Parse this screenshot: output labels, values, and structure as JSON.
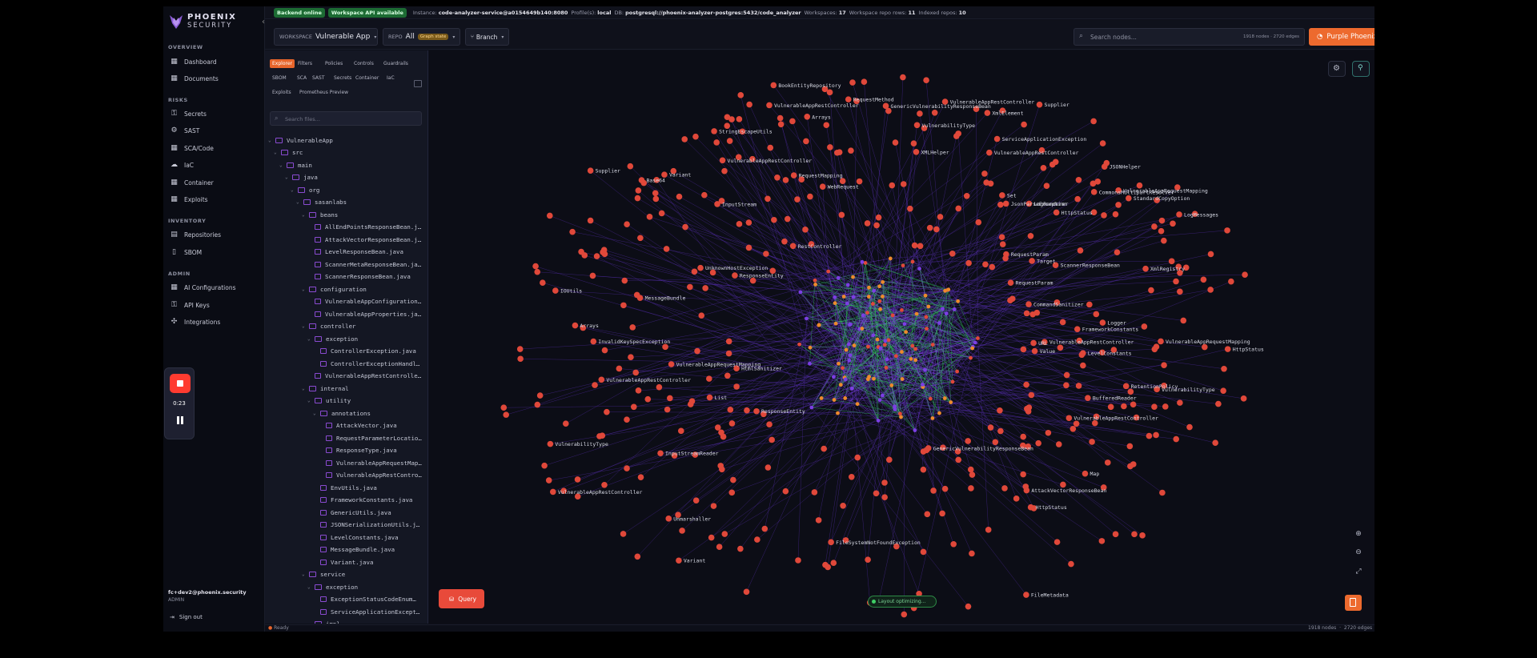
{
  "brand": {
    "name": "PHOENIX",
    "sub": "SECURITY"
  },
  "sidebar": {
    "sections": {
      "overview": "OVERVIEW",
      "risks": "RISKS",
      "inventory": "INVENTORY",
      "admin": "ADMIN"
    },
    "items": [
      {
        "label": "Dashboard",
        "icon": "grid-icon"
      },
      {
        "label": "Documents",
        "icon": "grid-icon"
      },
      {
        "label": "Secrets",
        "icon": "key-icon"
      },
      {
        "label": "SAST",
        "icon": "gear-icon"
      },
      {
        "label": "SCA/Code",
        "icon": "grid-icon"
      },
      {
        "label": "IaC",
        "icon": "cloud-icon"
      },
      {
        "label": "Container",
        "icon": "grid-icon"
      },
      {
        "label": "Exploits",
        "icon": "grid-icon"
      },
      {
        "label": "Repositories",
        "icon": "repo-icon"
      },
      {
        "label": "SBOM",
        "icon": "doc-icon"
      },
      {
        "label": "AI Configurations",
        "icon": "grid-icon"
      },
      {
        "label": "API Keys",
        "icon": "key-icon"
      },
      {
        "label": "Integrations",
        "icon": "puzzle-icon"
      }
    ],
    "user": "fc+dev2@phoenix.security",
    "role": "ADMIN",
    "signout": "Sign out",
    "recorder_time": "0:23"
  },
  "statusbar": {
    "backend": "Backend online",
    "workspace_api": "Workspace API available",
    "instance_label": "Instance:",
    "instance": "code-analyzer-service@a0154649b140:8080",
    "profile_label": "Profile(s):",
    "profile": "local",
    "db_label": "DB:",
    "db": "postgresql://phoenix-analyzer-postgres:5432/code_analyzer",
    "workspaces_label": "Workspaces:",
    "workspaces": "17",
    "repo_rows_label": "Workspace repo rows:",
    "repo_rows": "11",
    "indexed_label": "Indexed repos:",
    "indexed": "10"
  },
  "toolbar": {
    "workspace_label": "WORKSPACE",
    "workspace_value": "Vulnerable App",
    "repo_label": "REPO",
    "repo_value": "All",
    "graph_state": "Graph state",
    "branch": "Branch",
    "search_placeholder": "Search nodes...",
    "counts": "1918 nodes · 2720 edges",
    "triager": "Purple Phoenix Agentic Code Triager",
    "accent": "#ed6a2e"
  },
  "explorer": {
    "tabs_row1": [
      "Explorer",
      "Filters",
      "Policies",
      "Controls",
      "Guardrails"
    ],
    "tabs_row2": [
      "SBOM",
      "SCA",
      "SAST",
      "Secrets",
      "Container",
      "IaC"
    ],
    "tabs_row3": [
      "Exploits",
      "Prometheus Preview"
    ],
    "search_placeholder": "Search files...",
    "tree": [
      {
        "d": 0,
        "t": "dir",
        "name": "VulnerableApp"
      },
      {
        "d": 1,
        "t": "dir",
        "name": "src"
      },
      {
        "d": 2,
        "t": "dir",
        "name": "main"
      },
      {
        "d": 3,
        "t": "dir",
        "name": "java"
      },
      {
        "d": 4,
        "t": "dir",
        "name": "org"
      },
      {
        "d": 5,
        "t": "dir",
        "name": "sasanlabs"
      },
      {
        "d": 6,
        "t": "dir",
        "name": "beans"
      },
      {
        "d": 7,
        "t": "file",
        "name": "AllEndPointsResponseBean.j…"
      },
      {
        "d": 7,
        "t": "file",
        "name": "AttackVectorResponseBean.j…"
      },
      {
        "d": 7,
        "t": "file",
        "name": "LevelResponseBean.java"
      },
      {
        "d": 7,
        "t": "file",
        "name": "ScannerMetaResponseBean.ja…"
      },
      {
        "d": 7,
        "t": "file",
        "name": "ScannerResponseBean.java"
      },
      {
        "d": 6,
        "t": "dir",
        "name": "configuration"
      },
      {
        "d": 7,
        "t": "file",
        "name": "VulnerableAppConfiguration…"
      },
      {
        "d": 7,
        "t": "file",
        "name": "VulnerableAppProperties.ja…"
      },
      {
        "d": 6,
        "t": "dir",
        "name": "controller"
      },
      {
        "d": 7,
        "t": "dir",
        "name": "exception"
      },
      {
        "d": 8,
        "t": "file",
        "name": "ControllerException.java"
      },
      {
        "d": 8,
        "t": "file",
        "name": "ControllerExceptionHandl…"
      },
      {
        "d": 7,
        "t": "file",
        "name": "VulnerableAppRestControlle…"
      },
      {
        "d": 6,
        "t": "dir",
        "name": "internal"
      },
      {
        "d": 7,
        "t": "dir",
        "name": "utility"
      },
      {
        "d": 8,
        "t": "dir",
        "name": "annotations"
      },
      {
        "d": 9,
        "t": "file",
        "name": "AttackVector.java"
      },
      {
        "d": 9,
        "t": "file",
        "name": "RequestParameterLocatio…"
      },
      {
        "d": 9,
        "t": "file",
        "name": "ResponseType.java"
      },
      {
        "d": 9,
        "t": "file",
        "name": "VulnerableAppRequestMap…"
      },
      {
        "d": 9,
        "t": "file",
        "name": "VulnerableAppRestContro…"
      },
      {
        "d": 8,
        "t": "file",
        "name": "EnvUtils.java"
      },
      {
        "d": 8,
        "t": "file",
        "name": "FrameworkConstants.java"
      },
      {
        "d": 8,
        "t": "file",
        "name": "GenericUtils.java"
      },
      {
        "d": 8,
        "t": "file",
        "name": "JSONSerializationUtils.j…"
      },
      {
        "d": 8,
        "t": "file",
        "name": "LevelConstants.java"
      },
      {
        "d": 8,
        "t": "file",
        "name": "MessageBundle.java"
      },
      {
        "d": 8,
        "t": "file",
        "name": "Variant.java"
      },
      {
        "d": 6,
        "t": "dir",
        "name": "service"
      },
      {
        "d": 7,
        "t": "dir",
        "name": "exception"
      },
      {
        "d": 8,
        "t": "file",
        "name": "ExceptionStatusCodeEnum…"
      },
      {
        "d": 8,
        "t": "file",
        "name": "ServiceApplicationExcept…"
      },
      {
        "d": 7,
        "t": "dir",
        "name": "impl"
      }
    ]
  },
  "graph": {
    "labels": [
      "VulnerableAppRestController",
      "VulnerabilityType",
      "VulnerableAppRestController",
      "Variant",
      "Variant",
      "UnknownHostException",
      "ResponseEntity",
      "VulnerableAppRestController",
      "ResponseEntity",
      "RequestParam",
      "JSONHelper",
      "VulnerableAppRestController",
      "VulnerableAppRequestMapping",
      "Supplier",
      "MessageBundle",
      "HttpStatus",
      "InputStream",
      "Optional",
      "WebRequest",
      "GenericVulnerabilityResponseBean",
      "IOUtils",
      "XmlRegistry",
      "CommonsMultipartResolver",
      "InputStreamReader",
      "GenericVulnerabilityResponseBean",
      "URL",
      "ServiceApplicationException",
      "BookEntityRepository",
      "Logger",
      "VulnerableAppRestController",
      "InvalidKeySpecException",
      "BufferedReader",
      "Base64",
      "FileSystemNotFoundException",
      "VulnerabilityType",
      "RequestMapping",
      "VulnerableAppRequestMapping",
      "List",
      "HtmlSanitizer",
      "Arrays",
      "LogRenderer",
      "Target",
      "VulnerabilityType",
      "Unmarshaller",
      "XmlElement",
      "FileMetadata",
      "LevelConstants",
      "CommandSanitizer",
      "Arrays",
      "AttackVectorResponseBean",
      "RequestMethod",
      "HttpStatus",
      "Set",
      "Value",
      "VulnerableAppRestController",
      "FrameworkConstants",
      "HttpStatus",
      "ScannerResponseBean",
      "Supplier",
      "JsonParseException",
      "RequestParam",
      "Map",
      "LogMessages",
      "VulnerableAppRequestMapping",
      "StringEscapeUtils",
      "RetentionPolicy",
      "VulnerableAppRestController",
      "StandardCopyOption",
      "XMLHelper",
      "VulnerableAppRestController",
      "RestController"
    ],
    "layout_status": "Layout optimizing...",
    "query": "Query",
    "node_color": "#e0483a",
    "edge_color": "#5a2fb8",
    "core_edge_color": "#2fbf5a"
  },
  "footer": {
    "status": "Ready",
    "nodes": "1918 nodes",
    "edges": "2720 edges"
  }
}
